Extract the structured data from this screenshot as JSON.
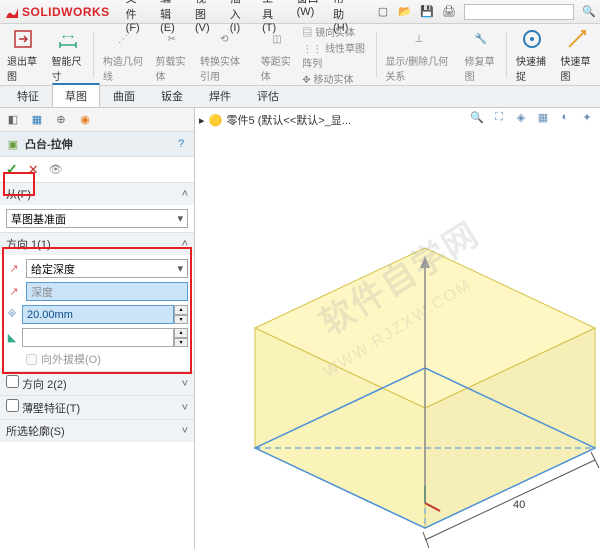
{
  "app": {
    "name": "SOLIDWORKS"
  },
  "menus": [
    "文件(F)",
    "编辑(E)",
    "视图(V)",
    "插入(I)",
    "工具(T)",
    "窗口(W)",
    "帮助(H)"
  ],
  "ribbon": [
    {
      "label": "退出草图"
    },
    {
      "label": "智能尺寸"
    },
    {
      "sep": true
    },
    {
      "label": "构造几何线"
    },
    {
      "label": "剪载实体"
    },
    {
      "label": "转换实体引用"
    },
    {
      "label": "等距实体"
    },
    {
      "label": "镜向实体"
    },
    {
      "label": "线性草图阵列"
    },
    {
      "label": "移动实体"
    },
    {
      "sep": true
    },
    {
      "label": "显示/删除几何关系"
    },
    {
      "label": "修复草图"
    },
    {
      "sep": true
    },
    {
      "label": "快速捕捉"
    },
    {
      "label": "快速草图"
    }
  ],
  "tabs": [
    "特征",
    "草图",
    "曲面",
    "钣金",
    "焊件",
    "评估"
  ],
  "tabs_active": 1,
  "feature": {
    "title": "凸台-拉伸"
  },
  "section_from": {
    "header": "从(F)",
    "value": "草图基准面"
  },
  "section_dir1": {
    "header": "方向 1(1)",
    "depth_type": "给定深度",
    "depth_placeholder": "深度",
    "depth_value": "20.00mm",
    "draft_label": "向外拔模(O)"
  },
  "section_dir2": {
    "header": "方向 2(2)"
  },
  "section_thin": {
    "header": "薄壁特征(T)"
  },
  "section_contour": {
    "header": "所选轮廓(S)"
  },
  "viewport": {
    "doc": "零件5 (默认<<默认>_显..."
  },
  "dim": {
    "width": "40"
  },
  "watermark": {
    "line1": "软件自学网",
    "line2": "WWW.RJZXW.COM"
  }
}
